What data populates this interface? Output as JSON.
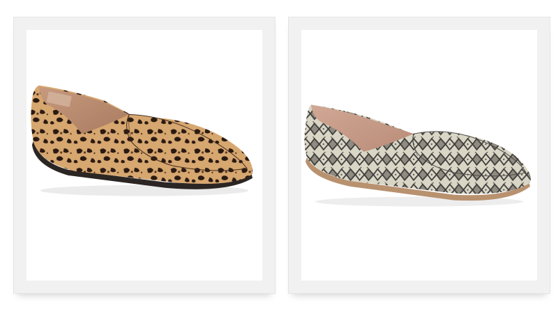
{
  "gallery": {
    "items": [
      {
        "pattern": "leopard",
        "colors": {
          "base": "#d7a770",
          "spot": "#2a1a12",
          "lining": "#b98a6e",
          "sole": "#2b2623"
        }
      },
      {
        "pattern": "snakeskin",
        "colors": {
          "base": "#d9d6c6",
          "scale": "#3c3b3a",
          "lining": "#c49a86",
          "sole": "#b8916f"
        }
      }
    ],
    "frame_color": "#f1f1f1",
    "photo_background": "#ffffff"
  }
}
